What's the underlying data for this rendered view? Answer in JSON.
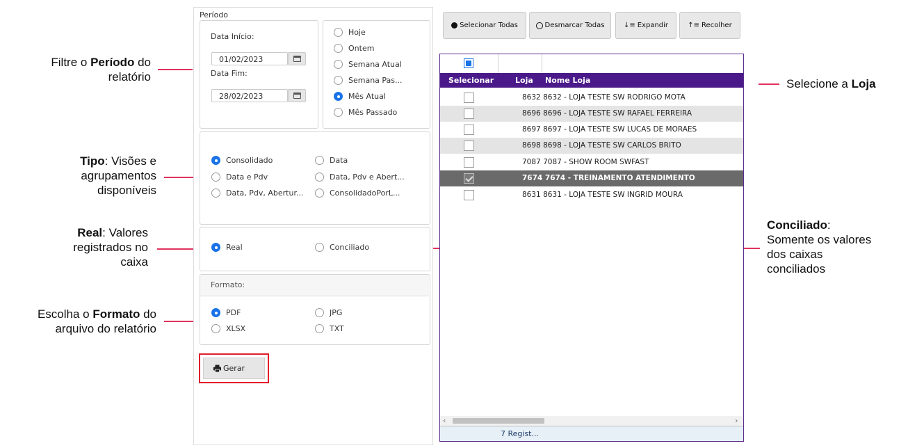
{
  "annotations": {
    "periodo": {
      "pre": "Filtre o ",
      "bold": "Período",
      "post": " do",
      "line2": "relatório"
    },
    "tipo": {
      "bold": "Tipo",
      "post": ": Visões e",
      "line2": "agrupamentos",
      "line3": "disponíveis"
    },
    "real": {
      "bold": "Real",
      "post": ": Valores",
      "line2": "registrados no",
      "line3": "caixa"
    },
    "formato": {
      "pre": "Escolha o ",
      "bold": "Formato",
      "post": " do",
      "line2": "arquivo do relatório"
    },
    "loja": {
      "pre": "Selecione a ",
      "bold": "Loja"
    },
    "conciliado": {
      "bold": "Conciliado",
      "post": ":",
      "line2": "Somente os valores",
      "line3": "dos caixas",
      "line4": "conciliados"
    }
  },
  "periodo": {
    "title": "Período",
    "data_inicio_label": "Data Início:",
    "data_inicio_value": "01/02/2023",
    "data_fim_label": "Data Fim:",
    "data_fim_value": "28/02/2023",
    "options": [
      "Hoje",
      "Ontem",
      "Semana Atual",
      "Semana Pas...",
      "Mês Atual",
      "Mês Passado"
    ],
    "selected": "Mês Atual"
  },
  "tipo": {
    "options": [
      "Consolidado",
      "Data",
      "Data e Pdv",
      "Data, Pdv e Abert...",
      "Data, Pdv, Abertur...",
      "ConsolidadoPorL..."
    ],
    "selected": "Consolidado"
  },
  "valores": {
    "options": [
      "Real",
      "Conciliado"
    ],
    "selected": "Real"
  },
  "formato": {
    "title": "Formato:",
    "options": [
      "PDF",
      "JPG",
      "XLSX",
      "TXT"
    ],
    "selected": "PDF"
  },
  "gerar_label": "Gerar",
  "toolbar": {
    "selecionar_todas": "Selecionar Todas",
    "desmarcar_todas": "Desmarcar Todas",
    "expandir": "Expandir",
    "recolher": "Recolher"
  },
  "grid": {
    "headers": {
      "selecionar": "Selecionar",
      "loja": "Loja",
      "nome_loja": "Nome Loja"
    },
    "rows": [
      {
        "loja": "8632",
        "nome": "8632 - LOJA TESTE SW RODRIGO MOTA",
        "checked": false
      },
      {
        "loja": "8696",
        "nome": "8696 - LOJA TESTE SW RAFAEL FERREIRA",
        "checked": false
      },
      {
        "loja": "8697",
        "nome": "8697 - LOJA TESTE SW LUCAS DE MORAES",
        "checked": false
      },
      {
        "loja": "8698",
        "nome": "8698 - LOJA TESTE SW CARLOS BRITO",
        "checked": false
      },
      {
        "loja": "7087",
        "nome": "7087 - SHOW ROOM SWFAST",
        "checked": false
      },
      {
        "loja": "7674",
        "nome": "7674 - TREINAMENTO ATENDIMENTO",
        "checked": true
      },
      {
        "loja": "8631",
        "nome": "8631 - LOJA TESTE SW INGRID MOURA",
        "checked": false
      }
    ],
    "footer": "7 Regist..."
  },
  "colors": {
    "accent": "#1a73e8",
    "grid_header": "#4b1a8a",
    "annotation_line": "#e0335e",
    "gerar_border": "#e01e2b"
  }
}
